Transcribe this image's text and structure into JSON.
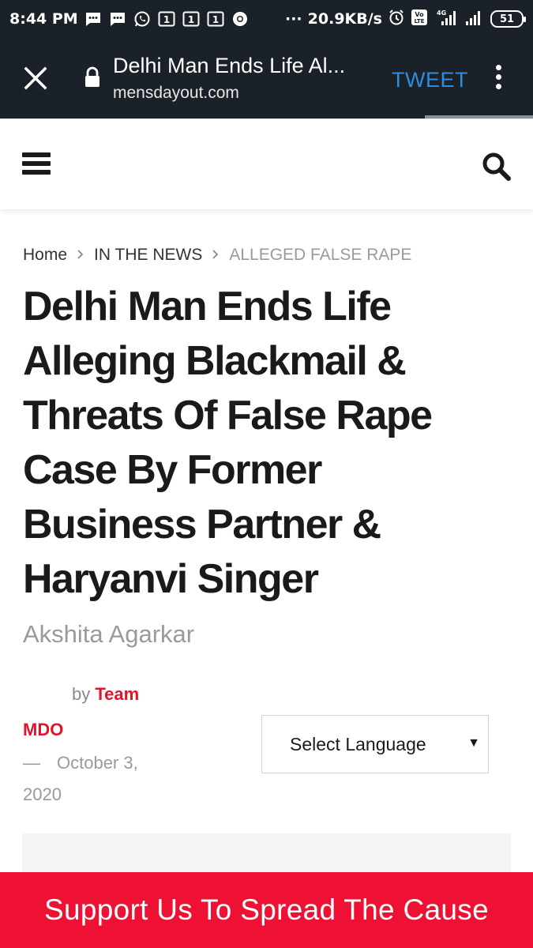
{
  "status_bar": {
    "time": "8:44 PM",
    "network_speed": "20.9KB/s",
    "network_type": "4G",
    "volte": "Vo LTE",
    "battery_level": "51",
    "notif_badge": "1",
    "overflow": "···"
  },
  "toolbar": {
    "page_title": "Delhi Man Ends Life Al...",
    "url": "mensdayout.com",
    "tweet_label": "TWEET",
    "colors": {
      "background": "#1b2128",
      "tweet": "#2d8ee0"
    }
  },
  "breadcrumb": {
    "home": "Home",
    "category": "IN THE NEWS",
    "current": "ALLEGED FALSE RAPE"
  },
  "article": {
    "title_lines": [
      "Delhi Man Ends Life",
      "Alleging Blackmail &",
      "Threats Of False Rape",
      "Case By Former",
      "Business Partner &",
      "Haryanvi Singer"
    ],
    "subtitle": "Akshita Agarkar",
    "by_label": "by",
    "author_first": "Team",
    "author_second": "MDO",
    "date_dash": "—",
    "date": "October 3,",
    "date_year": "2020"
  },
  "language_select": {
    "selected": "Select Language",
    "caret": "▼"
  },
  "banner": {
    "label": "Support Us To Spread The Cause",
    "color": "#ee1133"
  },
  "accent_color": "#e0142b"
}
